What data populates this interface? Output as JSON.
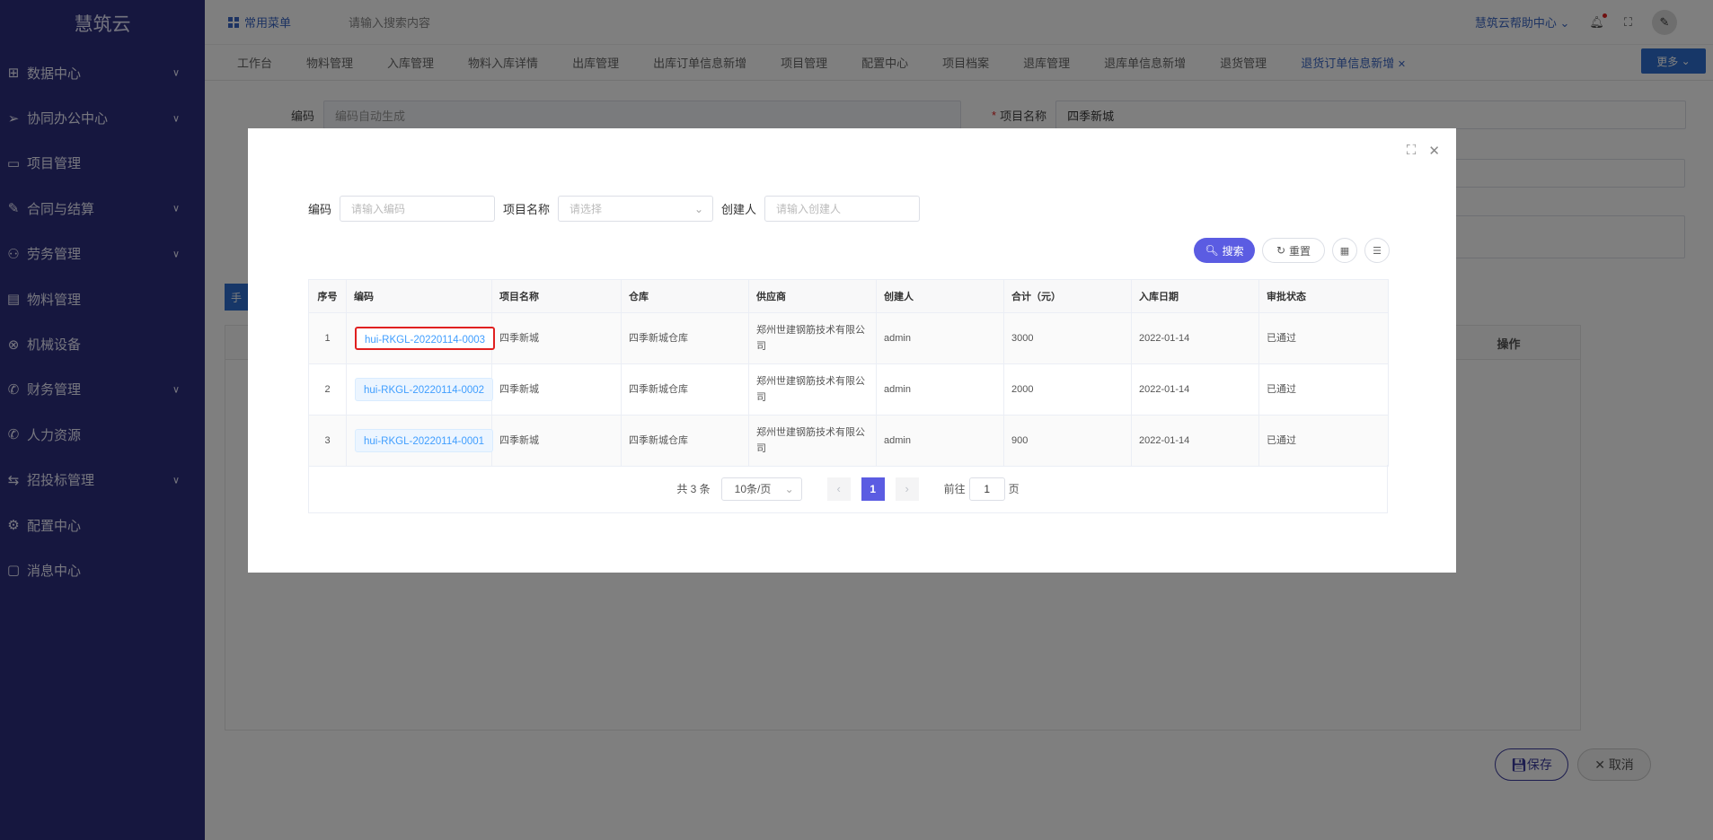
{
  "sidebar": {
    "brand": "慧筑云",
    "items": [
      {
        "label": "数据中心",
        "icon": "grid-icon",
        "arrow": true
      },
      {
        "label": "协同办公中心",
        "icon": "send-icon",
        "arrow": true
      },
      {
        "label": "项目管理",
        "icon": "book-icon",
        "arrow": false
      },
      {
        "label": "合同与结算",
        "icon": "document-icon",
        "arrow": true
      },
      {
        "label": "劳务管理",
        "icon": "worker-icon",
        "arrow": true
      },
      {
        "label": "物料管理",
        "icon": "file-icon",
        "arrow": false
      },
      {
        "label": "机械设备",
        "icon": "gear-circle-icon",
        "arrow": false
      },
      {
        "label": "财务管理",
        "icon": "phone-icon",
        "arrow": true
      },
      {
        "label": "人力资源",
        "icon": "phone-icon",
        "arrow": false
      },
      {
        "label": "招投标管理",
        "icon": "handshake-icon",
        "arrow": true
      },
      {
        "label": "配置中心",
        "icon": "settings-icon",
        "arrow": false
      },
      {
        "label": "消息中心",
        "icon": "message-icon",
        "arrow": false
      }
    ]
  },
  "topbar": {
    "favorites": "常用菜单",
    "search_placeholder": "请输入搜索内容",
    "help": "慧筑云帮助中心"
  },
  "tabs": [
    {
      "label": "工作台",
      "active": false
    },
    {
      "label": "物料管理",
      "active": false
    },
    {
      "label": "入库管理",
      "active": false
    },
    {
      "label": "物料入库详情",
      "active": false
    },
    {
      "label": "出库管理",
      "active": false
    },
    {
      "label": "出库订单信息新增",
      "active": false
    },
    {
      "label": "项目管理",
      "active": false
    },
    {
      "label": "配置中心",
      "active": false
    },
    {
      "label": "项目档案",
      "active": false
    },
    {
      "label": "退库管理",
      "active": false
    },
    {
      "label": "退库单信息新增",
      "active": false
    },
    {
      "label": "退货管理",
      "active": false
    },
    {
      "label": "退货订单信息新增",
      "active": true
    }
  ],
  "tabs_more": "更多",
  "form": {
    "code_label": "编码",
    "code_placeholder": "编码自动生成",
    "project_label": "项目名称",
    "project_required": "*",
    "project_value": "四季新城",
    "hand_button": "手",
    "operation_header": "操作",
    "save_label": "保存",
    "cancel_label": "取消"
  },
  "modal": {
    "search": {
      "code_label": "编码",
      "code_placeholder": "请输入编码",
      "project_label": "项目名称",
      "project_placeholder": "请选择",
      "creator_label": "创建人",
      "creator_placeholder": "请输入创建人"
    },
    "buttons": {
      "search": "搜索",
      "reset": "重置"
    },
    "columns": [
      "序号",
      "编码",
      "项目名称",
      "仓库",
      "供应商",
      "创建人",
      "合计（元）",
      "入库日期",
      "审批状态"
    ],
    "rows": [
      {
        "index": "1",
        "code": "hui-RKGL-20220114-0003",
        "project": "四季新城",
        "warehouse": "四季新城仓库",
        "supplier": "郑州世建钢筋技术有限公司",
        "creator": "admin",
        "total": "3000",
        "date": "2022-01-14",
        "status": "已通过",
        "highlight": true
      },
      {
        "index": "2",
        "code": "hui-RKGL-20220114-0002",
        "project": "四季新城",
        "warehouse": "四季新城仓库",
        "supplier": "郑州世建钢筋技术有限公司",
        "creator": "admin",
        "total": "2000",
        "date": "2022-01-14",
        "status": "已通过",
        "highlight": false
      },
      {
        "index": "3",
        "code": "hui-RKGL-20220114-0001",
        "project": "四季新城",
        "warehouse": "四季新城仓库",
        "supplier": "郑州世建钢筋技术有限公司",
        "creator": "admin",
        "total": "900",
        "date": "2022-01-14",
        "status": "已通过",
        "highlight": false
      }
    ],
    "pagination": {
      "total": "共 3 条",
      "page_size": "10条/页",
      "current": "1",
      "goto_prefix": "前往",
      "goto_value": "1",
      "goto_suffix": "页"
    }
  },
  "colors": {
    "sidebar_bg": "#2d2e7e",
    "primary": "#5b5ce2",
    "link": "#409eff",
    "highlight_border": "#e02020"
  }
}
